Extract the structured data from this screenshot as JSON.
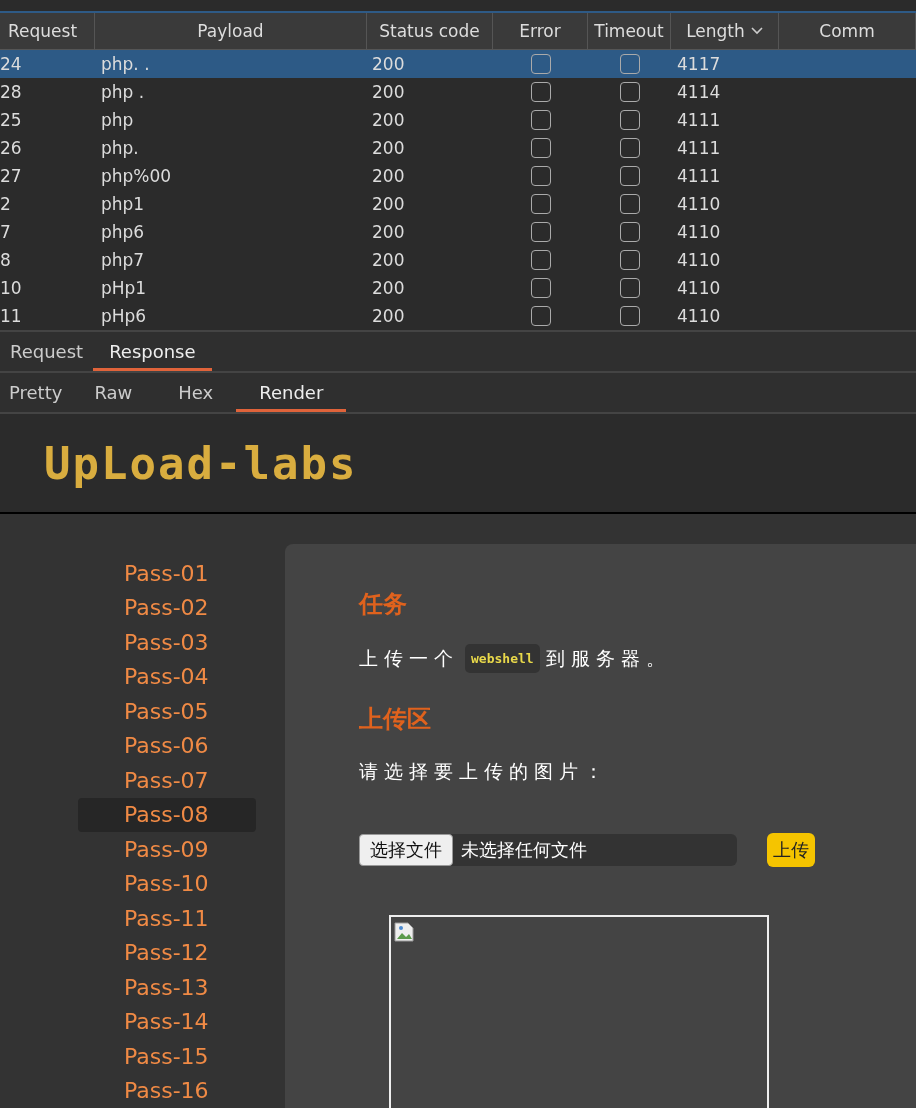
{
  "table": {
    "columns": [
      {
        "label": "Request"
      },
      {
        "label": "Payload"
      },
      {
        "label": "Status code"
      },
      {
        "label": "Error"
      },
      {
        "label": "Timeout"
      },
      {
        "label": "Length",
        "sorted": true
      },
      {
        "label": "Comm"
      }
    ],
    "rows": [
      {
        "request": "24",
        "payload": "php. .",
        "status": "200",
        "error": false,
        "timeout": false,
        "length": "4117",
        "selected": true
      },
      {
        "request": "28",
        "payload": "php .",
        "status": "200",
        "error": false,
        "timeout": false,
        "length": "4114",
        "selected": false
      },
      {
        "request": "25",
        "payload": "php",
        "status": "200",
        "error": false,
        "timeout": false,
        "length": "4111",
        "selected": false
      },
      {
        "request": "26",
        "payload": "php.",
        "status": "200",
        "error": false,
        "timeout": false,
        "length": "4111",
        "selected": false
      },
      {
        "request": "27",
        "payload": "php%00",
        "status": "200",
        "error": false,
        "timeout": false,
        "length": "4111",
        "selected": false
      },
      {
        "request": "2",
        "payload": "php1",
        "status": "200",
        "error": false,
        "timeout": false,
        "length": "4110",
        "selected": false
      },
      {
        "request": "7",
        "payload": "php6",
        "status": "200",
        "error": false,
        "timeout": false,
        "length": "4110",
        "selected": false
      },
      {
        "request": "8",
        "payload": "php7",
        "status": "200",
        "error": false,
        "timeout": false,
        "length": "4110",
        "selected": false
      },
      {
        "request": "10",
        "payload": "pHp1",
        "status": "200",
        "error": false,
        "timeout": false,
        "length": "4110",
        "selected": false
      },
      {
        "request": "11",
        "payload": "pHp6",
        "status": "200",
        "error": false,
        "timeout": false,
        "length": "4110",
        "selected": false
      }
    ]
  },
  "message_tabs": [
    {
      "label": "Request",
      "selected": false
    },
    {
      "label": "Response",
      "selected": true
    }
  ],
  "view_tabs": [
    {
      "label": "Pretty",
      "selected": false
    },
    {
      "label": "Raw",
      "selected": false
    },
    {
      "label": "Hex",
      "selected": false
    },
    {
      "label": "Render",
      "selected": true
    }
  ],
  "render": {
    "logo": "UpLoad-labs",
    "sidebar": [
      {
        "label": "Pass-01",
        "selected": false
      },
      {
        "label": "Pass-02",
        "selected": false
      },
      {
        "label": "Pass-03",
        "selected": false
      },
      {
        "label": "Pass-04",
        "selected": false
      },
      {
        "label": "Pass-05",
        "selected": false
      },
      {
        "label": "Pass-06",
        "selected": false
      },
      {
        "label": "Pass-07",
        "selected": false
      },
      {
        "label": "Pass-08",
        "selected": true
      },
      {
        "label": "Pass-09",
        "selected": false
      },
      {
        "label": "Pass-10",
        "selected": false
      },
      {
        "label": "Pass-11",
        "selected": false
      },
      {
        "label": "Pass-12",
        "selected": false
      },
      {
        "label": "Pass-13",
        "selected": false
      },
      {
        "label": "Pass-14",
        "selected": false
      },
      {
        "label": "Pass-15",
        "selected": false
      },
      {
        "label": "Pass-16",
        "selected": false
      }
    ],
    "task_heading": "任务",
    "task_before": "上传一个",
    "task_code": "webshell",
    "task_after": "到服务器。",
    "upload_heading": "上传区",
    "prompt": "请选择要上传的图片：",
    "choose_button": "选择文件",
    "file_status": "未选择任何文件",
    "upload_button": "上传"
  }
}
